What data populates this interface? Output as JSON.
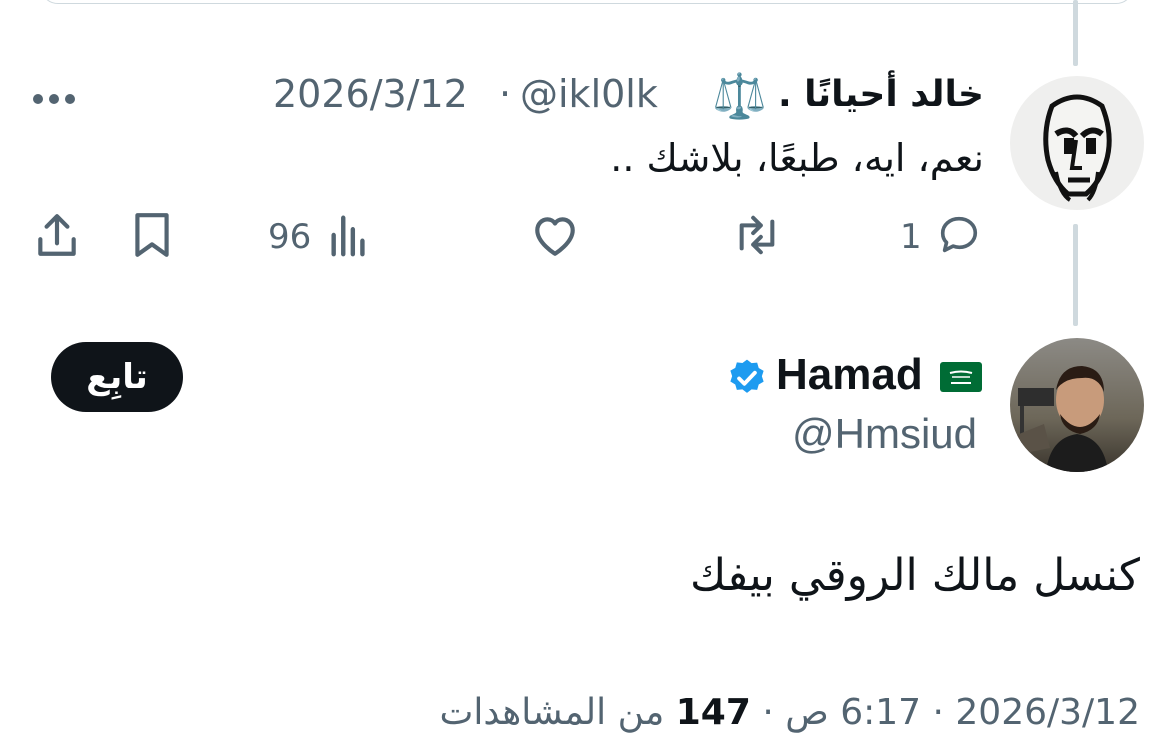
{
  "reply_tweet": {
    "display_name": "خالد أحيانًا .",
    "name_emoji": "⚖️",
    "handle": "@ikl0lk",
    "separator": "·",
    "date": "2026/3/12",
    "text": "نعم، ايه، طبعًا، بلاشك ..",
    "more_icon": "more-horizontal-icon",
    "actions": {
      "reply_count": "1",
      "views_count": "96"
    }
  },
  "main_tweet": {
    "display_name": "Hamad",
    "flag_emoji": "🇸🇦",
    "verified": true,
    "handle": "@Hmsiud",
    "follow_label": "تابِع",
    "text": "كنسل مالك الروقي بيفك",
    "timestamp_partial": "2026/3/12 · 6:17 ص",
    "views_count": "147",
    "views_label": "من المشاهدات"
  },
  "colors": {
    "accent": "#1d9bf0",
    "secondary_text": "#536471",
    "thread_line": "#cfd9de"
  }
}
